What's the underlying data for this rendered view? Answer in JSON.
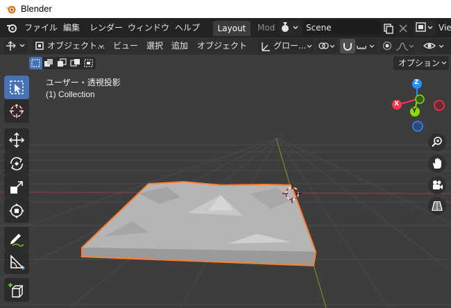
{
  "window": {
    "title": "Blender"
  },
  "topbar": {
    "menus": [
      "ファイル",
      "編集",
      "レンダー",
      "ウィンドウ",
      "ヘルプ"
    ],
    "active_tab": "Layout",
    "next_tab": "Mod",
    "scene_name": "Scene",
    "view_layer_partial": "Vie"
  },
  "header": {
    "mode_label": "オブジェクト...",
    "menus": [
      "ビュー",
      "選択",
      "追加",
      "オブジェクト"
    ],
    "orientation_label": "グロー...",
    "options_label": "オプション"
  },
  "viewport": {
    "view_label": "ユーザー・透視投影",
    "collection_label": "(1) Collection",
    "gizmo_axes": {
      "z": "Z",
      "x": "X",
      "y": "Y"
    }
  },
  "colors": {
    "accent": "#4772b3",
    "selection_outline": "#ff7f32",
    "axis_x": "#ff3352",
    "axis_y": "#8bdc00",
    "axis_z": "#2890ff"
  }
}
